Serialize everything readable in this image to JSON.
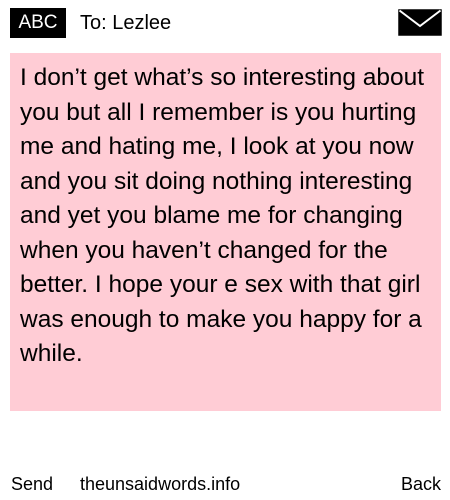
{
  "header": {
    "badge": "ABC",
    "to": "To: Lezlee",
    "icon": "envelope-icon"
  },
  "message": {
    "text": "I don’t get what’s so interesting about you but all I remember is you hurting me and hating me, I look at you now and you sit doing nothing interesting and yet you blame me for changing when you haven’t changed for the better. I hope your e sex with that girl was enough to make you happy for a while."
  },
  "footer": {
    "send_label": "Send",
    "site_label": "theunsaidwords.info",
    "back_label": "Back"
  },
  "colors": {
    "message_background": "#ffccd5",
    "badge_background": "#000000",
    "badge_text": "#ffffff"
  }
}
